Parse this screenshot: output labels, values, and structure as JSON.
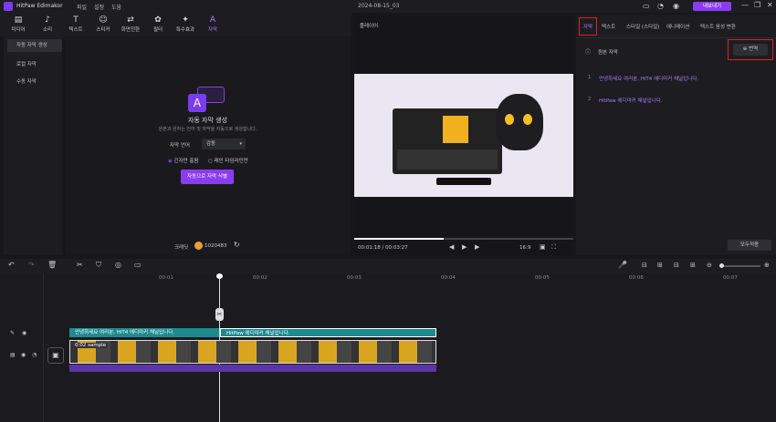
{
  "app": {
    "name": "HitPaw Edimakor",
    "menus": [
      "파일",
      "설정",
      "도움"
    ],
    "project_title": "2024-08-15_03",
    "export_label": "내보내기",
    "accent": "#8b3cf0",
    "highlight": "#e02020"
  },
  "toolbar": {
    "items": [
      {
        "label": "미디어",
        "icon": "media-icon"
      },
      {
        "label": "소리",
        "icon": "music-icon"
      },
      {
        "label": "텍스트",
        "icon": "text-icon"
      },
      {
        "label": "스티커",
        "icon": "sticker-icon"
      },
      {
        "label": "화면전환",
        "icon": "transition-icon"
      },
      {
        "label": "필터",
        "icon": "filter-icon"
      },
      {
        "label": "특수효과",
        "icon": "effect-icon"
      },
      {
        "label": "자막",
        "icon": "subtitle-icon"
      }
    ]
  },
  "leftnav": {
    "items": [
      "자동 자막 생성",
      "로컬 자막",
      "수동 자막"
    ]
  },
  "center": {
    "title": "자동 자막 생성",
    "desc": "원본과 원하는 언어 및 자막을 자동으로 생성합니다.",
    "lang_label": "자막 언어",
    "lang_value": "감동",
    "opt1": "긴자만 출음",
    "opt2": "래인 타임라인만",
    "generate_btn": "자동으로 자막 식별",
    "credits_label": "크레딧",
    "credits_value": "1020483"
  },
  "preview": {
    "header": "플레이어",
    "time": "00:01:18 / 00:03:27",
    "zoom": "16:9"
  },
  "right": {
    "tabs": [
      "자막",
      "텍스트",
      "스타일 (스타일)",
      "애니메이션",
      "텍스트 음성 변환"
    ],
    "original_label": "원본 자막",
    "translate_btn": "번역",
    "subtitles": [
      {
        "n": "1",
        "text": "안녕하세요 여러분, HiT4 에디마커 채널입니다."
      },
      {
        "n": "2",
        "text": "HitPaw 에디마커 채널입니다."
      }
    ],
    "apply_btn": "모두적용"
  },
  "timeline": {
    "ruler": [
      "00:01",
      "00:02",
      "00:03",
      "00:04",
      "00:05",
      "00:06",
      "00:07"
    ],
    "sub1": "안녕하세요 여러분, HiT4 에디마커 채널입니다.",
    "sub2": "HitPaw 에디마커 채널입니다.",
    "clip_label": "0:02 sample"
  }
}
